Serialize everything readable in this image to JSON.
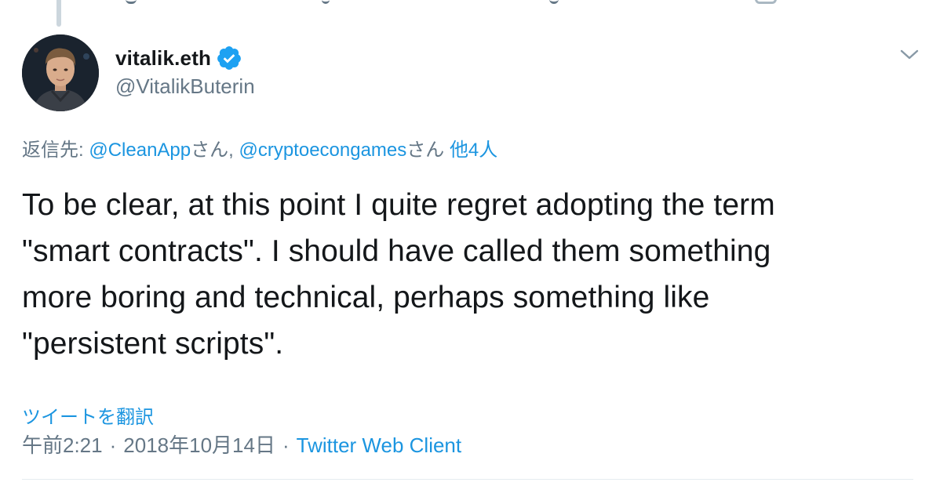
{
  "author": {
    "display_name": "vitalik.eth",
    "handle": "@VitalikButerin",
    "verified": true
  },
  "reply_context": {
    "prefix": "返信先: ",
    "mention1": "@CleanApp",
    "suffix1": "さん, ",
    "mention2": "@cryptoecongames",
    "suffix2": "さん ",
    "others": "他4人"
  },
  "tweet": {
    "lines": [
      "To be clear, at this point I quite regret adopting the term",
      "\"smart contracts\". I should have called them something",
      "more boring and technical, perhaps something like",
      "\"persistent scripts\"."
    ]
  },
  "actions": {
    "translate_label": "ツイートを翻訳"
  },
  "meta": {
    "time": "午前2:21",
    "separator": "·",
    "date": "2018年10月14日",
    "client": "Twitter Web Client"
  },
  "icons": {
    "verified": "verified-badge-icon",
    "menu": "chevron-down-icon"
  },
  "colors": {
    "link": "#1b95e0",
    "verified_badge": "#1da1f2",
    "secondary_text": "#657786",
    "primary_text": "#14171a"
  }
}
